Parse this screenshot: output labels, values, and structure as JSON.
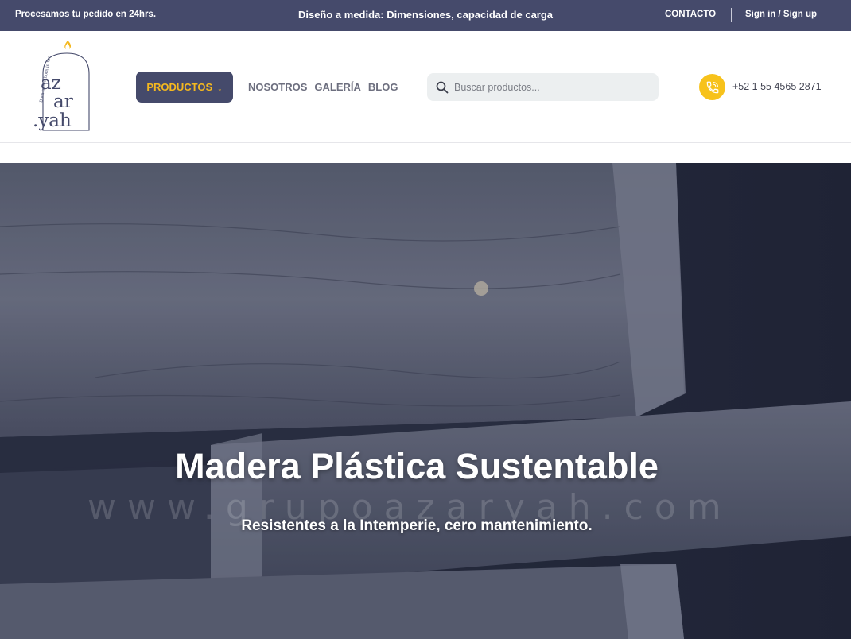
{
  "topbar": {
    "left_text": "Procesamos tu pedido en 24hrs.",
    "center_text": "Diseño a medida: Dimensiones, capacidad de carga",
    "contact_label": "CONTACTO",
    "sign_label": "Sign in / Sign up"
  },
  "header": {
    "logo": {
      "letters_line1": "az",
      "letters_line2": "ar",
      "letters_line3": ".yah",
      "arch_text": "Born in fire  Born in fire"
    },
    "productos_label": "PRODUCTOS",
    "productos_arrow": "↓",
    "nav": [
      {
        "label": "NOSOTROS"
      },
      {
        "label": "GALERÍA"
      },
      {
        "label": "BLOG"
      }
    ],
    "search_placeholder": "Buscar productos...",
    "phone": "+52 1 55 4565 2871"
  },
  "hero": {
    "title": "Madera Plástica Sustentable",
    "watermark": "www.grupoazaryah.com",
    "subtitle": "Resistentes a la Intemperie, cero mantenimiento."
  },
  "colors": {
    "topbar_bg": "#454a6b",
    "accent_yellow": "#f4b81f",
    "phone_icon_bg": "#f7c21b",
    "search_bg": "#eceff0"
  },
  "icons": {
    "search": "search-icon",
    "phone": "phone-icon",
    "flame": "flame-icon"
  }
}
